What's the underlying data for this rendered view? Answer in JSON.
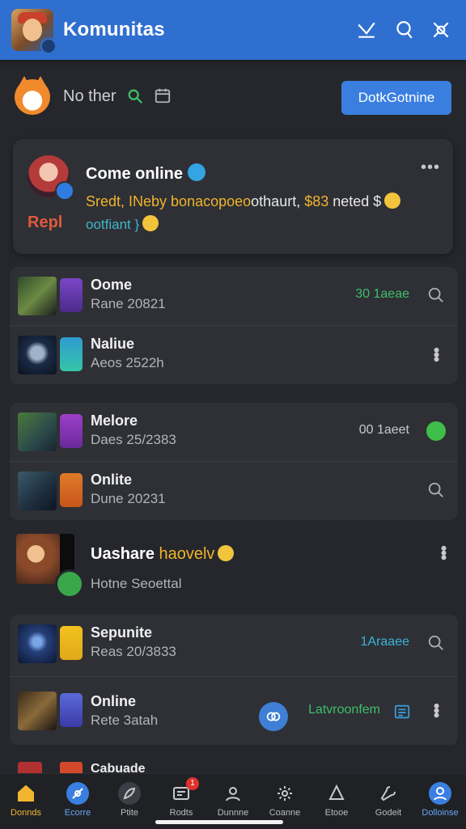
{
  "header": {
    "title": "Komunitas"
  },
  "subbar": {
    "label": "No ther",
    "go_online": "DotkGotnine"
  },
  "featured": {
    "title": "Come online",
    "reply": "Repl",
    "line1_a": "Sredt, INeby ",
    "line1_b": "bonacopoeo",
    "line1_c": "othaurt, ",
    "line1_d": "$83",
    "line1_e": " neted $",
    "line2": "ootfiant }",
    "more": "•••"
  },
  "group1": [
    {
      "title": "Oome",
      "sub": "Rane 20821",
      "status": "30 1aeae",
      "status_color": "#3fbf6a",
      "action": "search-icon"
    },
    {
      "title": "Naliue",
      "sub": "Aeos 2522h",
      "status": "",
      "action": "more-vert-icon"
    }
  ],
  "group2": [
    {
      "title": "Melore",
      "sub": "Daes 25/2383",
      "status": "00 1aeet",
      "status_color": "#c9c9cd",
      "action": "green-dot-icon"
    },
    {
      "title": "Onlite",
      "sub": "Dune 20231",
      "status": "",
      "action": "search-icon"
    }
  ],
  "solo": {
    "title_a": "Uashare ",
    "title_b": "haovelv",
    "sub": "Hotne Seoettal"
  },
  "group3": [
    {
      "title": "Sepunite",
      "sub": "Reas 20/3833",
      "status": "1Araaee",
      "status_color": "#3ab4d8",
      "action": "chat-search-icon"
    },
    {
      "title": "Online",
      "sub": "Rete 3atah",
      "status": "Latvroonfem",
      "status_color": "#3fbf6a",
      "action": "more-vert-icon"
    }
  ],
  "peek": {
    "title": "Cabuade"
  },
  "nav": [
    {
      "label": "Donnds",
      "icon": "home-icon",
      "badge": ""
    },
    {
      "label": "Ecorre",
      "icon": "compass-icon",
      "badge": ""
    },
    {
      "label": "Ptite",
      "icon": "feather-icon",
      "badge": ""
    },
    {
      "label": "Rodts",
      "icon": "news-icon",
      "badge": "1"
    },
    {
      "label": "Dunnne",
      "icon": "profile-icon",
      "badge": ""
    },
    {
      "label": "Coanne",
      "icon": "settings-icon",
      "badge": ""
    },
    {
      "label": "Etooe",
      "icon": "people-icon",
      "badge": ""
    },
    {
      "label": "Godeit",
      "icon": "tools-icon",
      "badge": ""
    },
    {
      "label": "Dolloinse",
      "icon": "account-icon",
      "badge": ""
    }
  ],
  "colors": {
    "accent": "#2f6fd0",
    "background": "#25272c",
    "card": "#2e3035",
    "highlight": "#f0b32c"
  }
}
